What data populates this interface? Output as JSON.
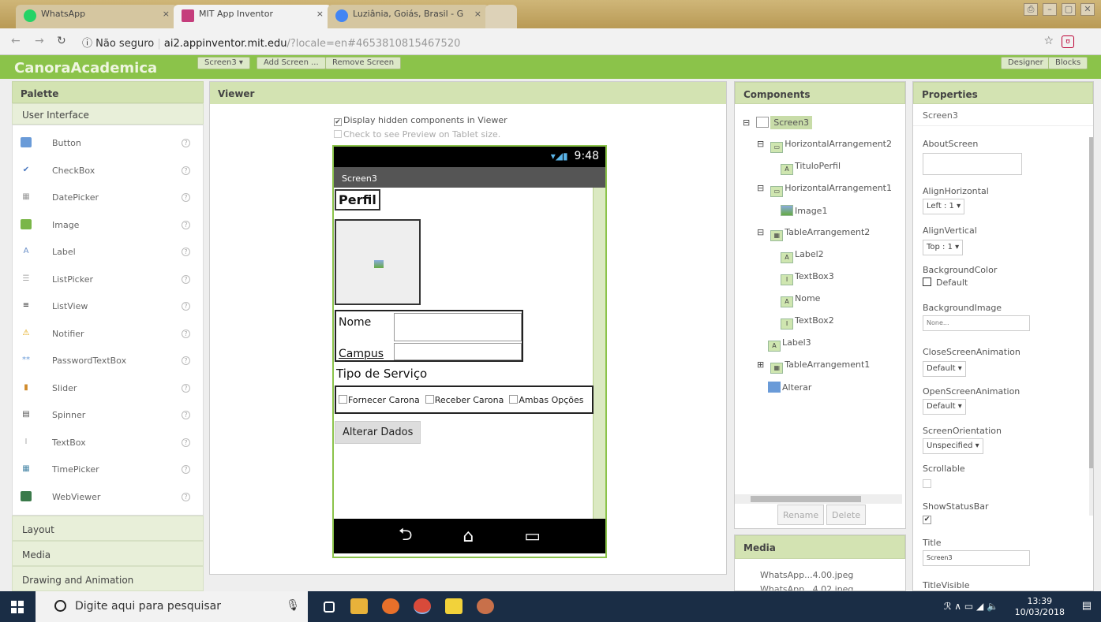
{
  "browser": {
    "tabs": [
      {
        "label": "WhatsApp",
        "color": "#25d366",
        "close": "×"
      },
      {
        "label": "MIT App Inventor",
        "color": "#c53d7c",
        "close": "×"
      },
      {
        "label": "Luziânia, Goiás, Brasil - G",
        "color": "#4285f4",
        "close": "×"
      }
    ],
    "security": "Não seguro",
    "url_domain": "ai2.appinventor.mit.edu",
    "url_rest": "/?locale=en#4653810815467520",
    "bookmark_star": "☆"
  },
  "app_header": {
    "title": "CanoraAcademica",
    "buttons": {
      "screens": "Screen3 ▾",
      "add_screen": "Add Screen ...",
      "remove_screen": "Remove Screen",
      "designer": "Designer",
      "blocks": "Blocks"
    }
  },
  "palette": {
    "title": "Palette",
    "sections": {
      "user_interface": "User Interface",
      "layout": "Layout",
      "media": "Media",
      "drawing": "Drawing and Animation"
    },
    "items": [
      {
        "label": "Button",
        "icon": "button-icon",
        "glyph": "",
        "color": "#6a9bd8"
      },
      {
        "label": "CheckBox",
        "icon": "checkbox-icon",
        "glyph": "✔",
        "color": "#4a78c0"
      },
      {
        "label": "DatePicker",
        "icon": "datepicker-icon",
        "glyph": "▦",
        "color": "#999"
      },
      {
        "label": "Image",
        "icon": "image-icon",
        "glyph": "",
        "color": "#7ab648"
      },
      {
        "label": "Label",
        "icon": "label-icon",
        "glyph": "A",
        "color": "#6a8fc8"
      },
      {
        "label": "ListPicker",
        "icon": "listpicker-icon",
        "glyph": "☰",
        "color": "#aaa"
      },
      {
        "label": "ListView",
        "icon": "listview-icon",
        "glyph": "≡",
        "color": "#222"
      },
      {
        "label": "Notifier",
        "icon": "notifier-icon",
        "glyph": "⚠",
        "color": "#e0a000"
      },
      {
        "label": "PasswordTextBox",
        "icon": "password-icon",
        "glyph": "**",
        "color": "#6a9bd8"
      },
      {
        "label": "Slider",
        "icon": "slider-icon",
        "glyph": "▮",
        "color": "#d08a2a"
      },
      {
        "label": "Spinner",
        "icon": "spinner-icon",
        "glyph": "▤",
        "color": "#555"
      },
      {
        "label": "TextBox",
        "icon": "textbox-icon",
        "glyph": "I",
        "color": "#aaa"
      },
      {
        "label": "TimePicker",
        "icon": "timepicker-icon",
        "glyph": "▦",
        "color": "#4a88a8"
      },
      {
        "label": "WebViewer",
        "icon": "webviewer-icon",
        "glyph": "",
        "color": "#3a7a4a"
      }
    ],
    "help_glyph": "?"
  },
  "viewer": {
    "title": "Viewer",
    "display_hidden": "Display hidden components in Viewer",
    "tablet_preview": "Check to see Preview on Tablet size.",
    "phone": {
      "time": "9:48",
      "signal": "▾◢▮",
      "screen_title": "Screen3",
      "perfil": "Perfil",
      "nome": "Nome",
      "campus": "Campus",
      "tipo": "Tipo de Serviço",
      "checks": [
        "Fornecer Carona",
        "Receber Carona",
        "Ambas Opções"
      ],
      "button": "Alterar Dados",
      "nav": {
        "back": "⮌",
        "home": "⌂",
        "recent": "▭"
      }
    }
  },
  "components": {
    "title": "Components",
    "tree": [
      {
        "label": "Screen3",
        "toggle": "⊟",
        "glyph": ""
      },
      {
        "label": "HorizontalArrangement2",
        "toggle": "⊟",
        "glyph": "▭"
      },
      {
        "label": "TituloPerfil",
        "toggle": "",
        "glyph": "A"
      },
      {
        "label": "HorizontalArrangement1",
        "toggle": "⊟",
        "glyph": "▭"
      },
      {
        "label": "Image1",
        "toggle": "",
        "glyph": ""
      },
      {
        "label": "TableArrangement2",
        "toggle": "⊟",
        "glyph": "▦"
      },
      {
        "label": "Label2",
        "toggle": "",
        "glyph": "A"
      },
      {
        "label": "TextBox3",
        "toggle": "",
        "glyph": "I"
      },
      {
        "label": "Nome",
        "toggle": "",
        "glyph": "A"
      },
      {
        "label": "TextBox2",
        "toggle": "",
        "glyph": "I"
      },
      {
        "label": "Label3",
        "toggle": "",
        "glyph": "A"
      },
      {
        "label": "TableArrangement1",
        "toggle": "⊞",
        "glyph": "▦"
      },
      {
        "label": "Alterar",
        "toggle": "",
        "glyph": ""
      }
    ],
    "rename": "Rename",
    "delete": "Delete"
  },
  "media": {
    "title": "Media",
    "files": [
      "WhatsApp...4.00.jpeg",
      "WhatsApp...4.02.jpeg"
    ]
  },
  "properties": {
    "title": "Properties",
    "component": "Screen3",
    "about_screen": "AboutScreen",
    "align_horizontal": "AlignHorizontal",
    "align_horizontal_value": "Left : 1 ▾",
    "align_vertical": "AlignVertical",
    "align_vertical_value": "Top : 1 ▾",
    "background_color": "BackgroundColor",
    "background_color_value": "Default",
    "background_image": "BackgroundImage",
    "background_image_value": "None...",
    "close_anim": "CloseScreenAnimation",
    "close_anim_value": "Default ▾",
    "open_anim": "OpenScreenAnimation",
    "open_anim_value": "Default ▾",
    "orientation": "ScreenOrientation",
    "orientation_value": "Unspecified ▾",
    "scrollable": "Scrollable",
    "show_status": "ShowStatusBar",
    "title_prop": "Title",
    "title_value": "Screen3",
    "title_visible": "TitleVisible",
    "checked_glyph": "✔"
  },
  "taskbar": {
    "search": "Digite aqui para pesquisar",
    "time": "13:39",
    "date": "10/03/2018",
    "tray": "ℛ  ∧  ▭  ◢  🔈"
  },
  "colors": {
    "accent": "#8bc34a",
    "panel_head": "#d3e3b2"
  }
}
